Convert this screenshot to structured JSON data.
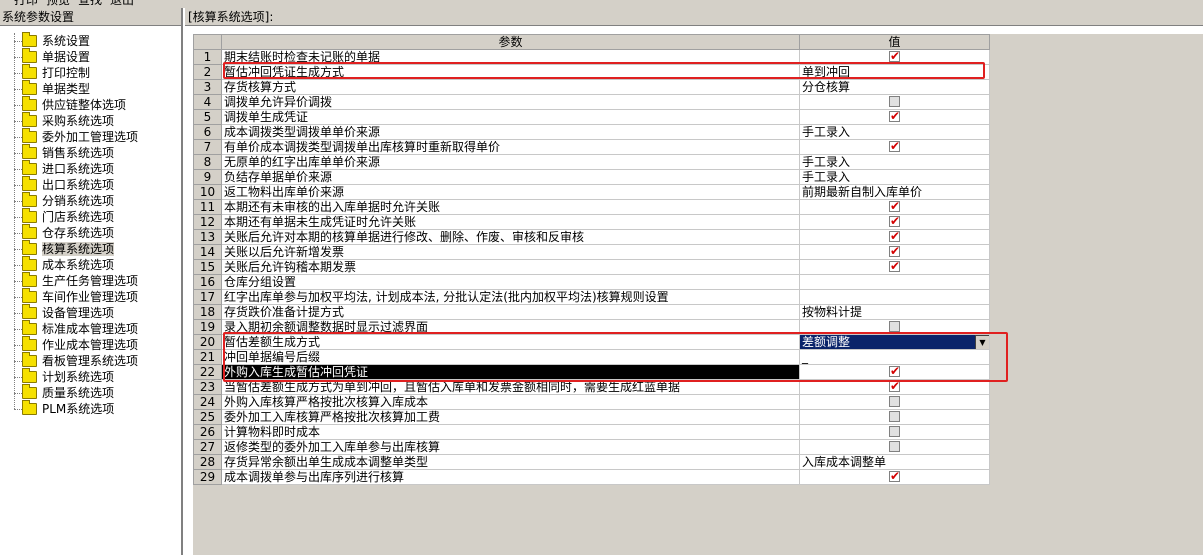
{
  "menu": [
    "打印",
    "预览",
    "查找",
    "退出"
  ],
  "left_panel": {
    "title": "系统参数设置",
    "items": [
      {
        "label": "系统设置"
      },
      {
        "label": "单据设置"
      },
      {
        "label": "打印控制"
      },
      {
        "label": "单据类型"
      },
      {
        "label": "供应链整体选项"
      },
      {
        "label": "采购系统选项"
      },
      {
        "label": "委外加工管理选项"
      },
      {
        "label": "销售系统选项"
      },
      {
        "label": "进口系统选项"
      },
      {
        "label": "出口系统选项"
      },
      {
        "label": "分销系统选项"
      },
      {
        "label": "门店系统选项"
      },
      {
        "label": "仓存系统选项"
      },
      {
        "label": "核算系统选项",
        "selected": true
      },
      {
        "label": "成本系统选项"
      },
      {
        "label": "生产任务管理选项"
      },
      {
        "label": "车间作业管理选项"
      },
      {
        "label": "设备管理选项"
      },
      {
        "label": "标准成本管理选项"
      },
      {
        "label": "作业成本管理选项"
      },
      {
        "label": "看板管理系统选项"
      },
      {
        "label": "计划系统选项"
      },
      {
        "label": "质量系统选项"
      },
      {
        "label": "PLM系统选项"
      }
    ]
  },
  "right_panel": {
    "title": "[核算系统选项]:",
    "columns": {
      "param": "参数",
      "value": "值"
    },
    "rows": [
      {
        "no": "1",
        "param": "期末结账时检查未记账的单据",
        "type": "check",
        "checked": true
      },
      {
        "no": "2",
        "param": "暂估冲回凭证生成方式",
        "type": "text",
        "value": "单到冲回"
      },
      {
        "no": "3",
        "param": "存货核算方式",
        "type": "text",
        "value": "分仓核算"
      },
      {
        "no": "4",
        "param": "调拨单允许异价调拨",
        "type": "check",
        "checked": false
      },
      {
        "no": "5",
        "param": "调拨单生成凭证",
        "type": "check",
        "checked": true
      },
      {
        "no": "6",
        "param": "成本调拨类型调拨单单价来源",
        "type": "text",
        "value": "手工录入"
      },
      {
        "no": "7",
        "param": "有单价成本调拨类型调拨单出库核算时重新取得单价",
        "type": "check",
        "checked": true
      },
      {
        "no": "8",
        "param": "无原单的红字出库单单价来源",
        "type": "text",
        "value": "手工录入"
      },
      {
        "no": "9",
        "param": "负结存单据单价来源",
        "type": "text",
        "value": "手工录入"
      },
      {
        "no": "10",
        "param": "返工物料出库单价来源",
        "type": "text",
        "value": "前期最新自制入库单价"
      },
      {
        "no": "11",
        "param": "本期还有未审核的出入库单据时允许关账",
        "type": "check",
        "checked": true
      },
      {
        "no": "12",
        "param": "本期还有单据未生成凭证时允许关账",
        "type": "check",
        "checked": true
      },
      {
        "no": "13",
        "param": "关账后允许对本期的核算单据进行修改、删除、作废、审核和反审核",
        "type": "check",
        "checked": true
      },
      {
        "no": "14",
        "param": "关账以后允许新增发票",
        "type": "check",
        "checked": true
      },
      {
        "no": "15",
        "param": "关账后允许钩稽本期发票",
        "type": "check",
        "checked": true
      },
      {
        "no": "16",
        "param": "仓库分组设置",
        "type": "text",
        "value": ""
      },
      {
        "no": "17",
        "param": "红字出库单参与加权平均法, 计划成本法, 分批认定法(批内加权平均法)核算规则设置",
        "type": "text",
        "value": ""
      },
      {
        "no": "18",
        "param": "存货跌价准备计提方式",
        "type": "text",
        "value": "按物料计提"
      },
      {
        "no": "19",
        "param": "录入期初余额调整数据时显示过滤界面",
        "type": "check",
        "checked": false
      },
      {
        "no": "20",
        "param": "暂估差额生成方式",
        "type": "select",
        "value": "差额调整"
      },
      {
        "no": "21",
        "param": "冲回单据编号后缀",
        "type": "text",
        "value": "_"
      },
      {
        "no": "22",
        "param": "外购入库生成暂估冲回凭证",
        "type": "check",
        "checked": true,
        "highlight": true
      },
      {
        "no": "23",
        "param": "当暂估差额生成方式为单到冲回，且暂估入库单和发票金额相同时，需要生成红蓝单据",
        "type": "check",
        "checked": true
      },
      {
        "no": "24",
        "param": "外购入库核算严格按批次核算入库成本",
        "type": "check",
        "checked": false
      },
      {
        "no": "25",
        "param": "委外加工入库核算严格按批次核算加工费",
        "type": "check",
        "checked": false
      },
      {
        "no": "26",
        "param": "计算物料即时成本",
        "type": "check",
        "checked": false
      },
      {
        "no": "27",
        "param": "返修类型的委外加工入库单参与出库核算",
        "type": "check",
        "checked": false
      },
      {
        "no": "28",
        "param": "存货异常余额出单生成成本调整单类型",
        "type": "text",
        "value": "入库成本调整单"
      },
      {
        "no": "29",
        "param": "成本调拨单参与出库序列进行核算",
        "type": "check",
        "checked": true
      }
    ]
  },
  "colors": {
    "highlight_border": "#e02020",
    "check_mark": "#d40000",
    "selection": "#0a246a"
  }
}
